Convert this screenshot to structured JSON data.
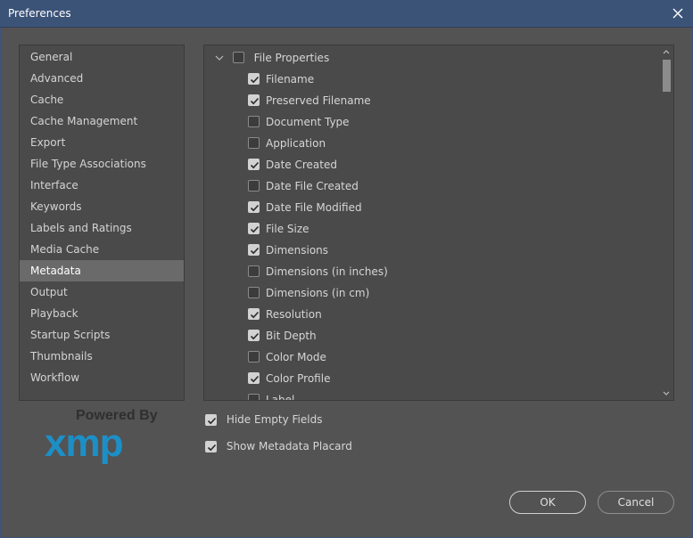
{
  "window": {
    "title": "Preferences"
  },
  "sidebar": {
    "items": [
      {
        "label": "General",
        "selected": false
      },
      {
        "label": "Advanced",
        "selected": false
      },
      {
        "label": "Cache",
        "selected": false
      },
      {
        "label": "Cache Management",
        "selected": false
      },
      {
        "label": "Export",
        "selected": false
      },
      {
        "label": "File Type Associations",
        "selected": false
      },
      {
        "label": "Interface",
        "selected": false
      },
      {
        "label": "Keywords",
        "selected": false
      },
      {
        "label": "Labels and Ratings",
        "selected": false
      },
      {
        "label": "Media Cache",
        "selected": false
      },
      {
        "label": "Metadata",
        "selected": true
      },
      {
        "label": "Output",
        "selected": false
      },
      {
        "label": "Playback",
        "selected": false
      },
      {
        "label": "Startup Scripts",
        "selected": false
      },
      {
        "label": "Thumbnails",
        "selected": false
      },
      {
        "label": "Workflow",
        "selected": false
      }
    ]
  },
  "metadata": {
    "group": {
      "label": "File Properties",
      "checked": false,
      "expanded": true
    },
    "fields": [
      {
        "label": "Filename",
        "checked": true
      },
      {
        "label": "Preserved Filename",
        "checked": true
      },
      {
        "label": "Document Type",
        "checked": false
      },
      {
        "label": "Application",
        "checked": false
      },
      {
        "label": "Date Created",
        "checked": true
      },
      {
        "label": "Date File Created",
        "checked": false
      },
      {
        "label": "Date File Modified",
        "checked": true
      },
      {
        "label": "File Size",
        "checked": true
      },
      {
        "label": "Dimensions",
        "checked": true
      },
      {
        "label": "Dimensions (in inches)",
        "checked": false
      },
      {
        "label": "Dimensions (in cm)",
        "checked": false
      },
      {
        "label": "Resolution",
        "checked": true
      },
      {
        "label": "Bit Depth",
        "checked": true
      },
      {
        "label": "Color Mode",
        "checked": false
      },
      {
        "label": "Color Profile",
        "checked": true
      },
      {
        "label": "Label",
        "checked": false
      }
    ]
  },
  "options": {
    "hide_empty": {
      "label": "Hide Empty Fields",
      "checked": true
    },
    "show_placard": {
      "label": "Show Metadata Placard",
      "checked": true
    }
  },
  "branding": {
    "powered_by": "Powered By",
    "logo_text": "xmp"
  },
  "buttons": {
    "ok": "OK",
    "cancel": "Cancel"
  },
  "colors": {
    "titlebar": "#3c5378",
    "dialog_bg": "#535353",
    "panel_bg": "#4a4a4a",
    "selected_bg": "#6a6a6a",
    "xmp_blue": "#1d8fc7"
  }
}
